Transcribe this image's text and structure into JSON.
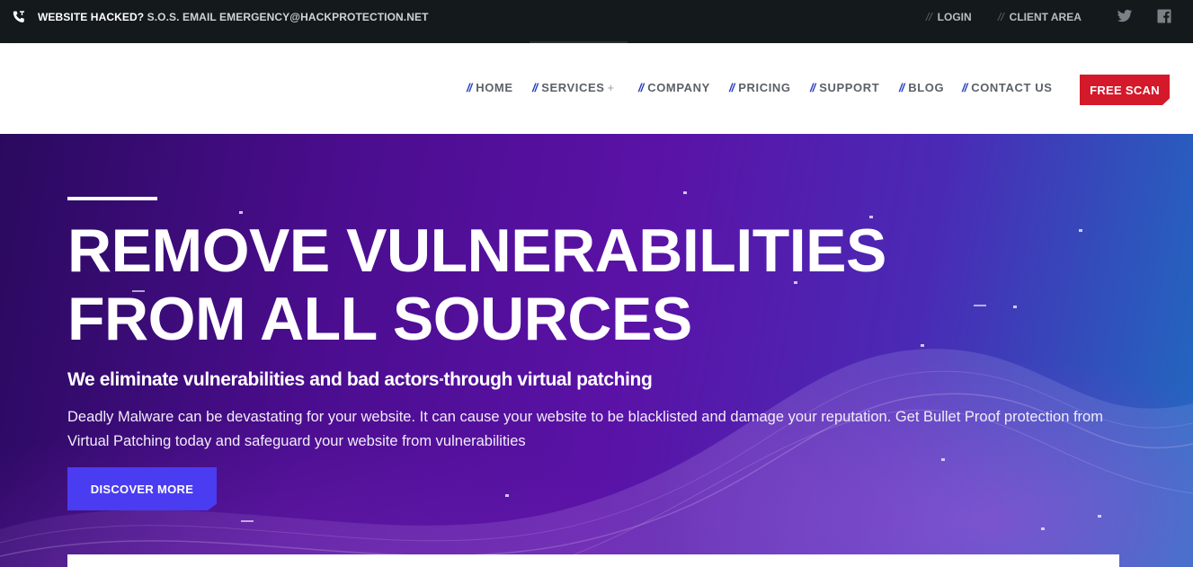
{
  "topbar": {
    "alert_lead": "WEBSITE HACKED?",
    "alert_text": "S.O.S. EMAIL EMERGENCY@HACKPROTECTION.NET",
    "login": "LOGIN",
    "client_area": "CLIENT AREA",
    "slashes": "//",
    "icons": [
      "phone-icon",
      "twitter-icon",
      "facebook-icon"
    ]
  },
  "nav": {
    "slashes": "//",
    "items": [
      {
        "label": "HOME"
      },
      {
        "label": "SERVICES",
        "suffix": "+"
      },
      {
        "label": "COMPANY"
      },
      {
        "label": "PRICING"
      },
      {
        "label": "SUPPORT"
      },
      {
        "label": "BLOG"
      },
      {
        "label": "CONTACT US"
      }
    ],
    "cta": "FREE SCAN"
  },
  "hero": {
    "title": "REMOVE VULNERABILITIES FROM ALL SOURCES",
    "subtitle": "We eliminate vulnerabilities and bad actors through virtual patching",
    "body": "Deadly Malware can be devastating for your website. It can cause your website to be blacklisted and damage your reputation. Get Bullet Proof protection from Virtual Patching today and safeguard your website from vulnerabilities",
    "button": "DISCOVER MORE"
  },
  "colors": {
    "topbar_bg": "#14191c",
    "accent_blue": "#2a3fbf",
    "cta_red": "#d4192b",
    "button_purple": "#4a3cf0",
    "hero_start": "#2a0a5e",
    "hero_end": "#1f6bc0"
  }
}
